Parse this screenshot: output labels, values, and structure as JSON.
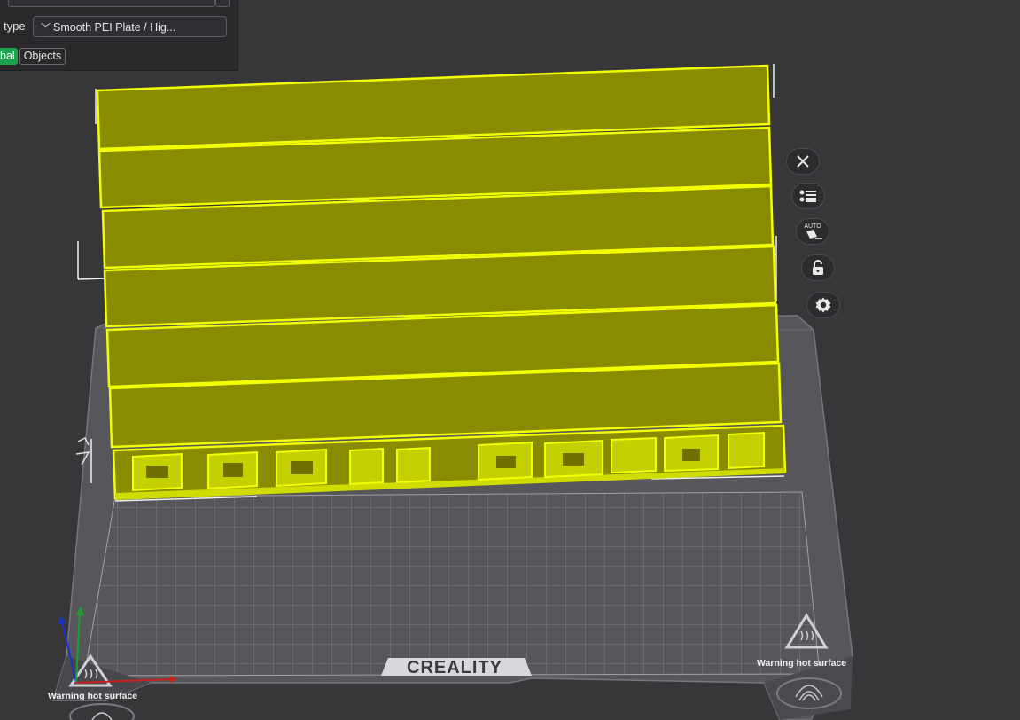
{
  "panel": {
    "type_label": "type",
    "plate_type_value": "Smooth PEI Plate / Hig...",
    "tabs": {
      "global": "bal",
      "objects": "Objects"
    }
  },
  "bed": {
    "brand": "CREALITY",
    "warning_left": "Warning hot surface",
    "warning_right": "Warning hot surface"
  },
  "model": {
    "color": "#8a8c00",
    "outline": "#f2ff00",
    "text_ridge_color": "#e8f200"
  },
  "toolbar": {
    "auto_label": "AUTO",
    "icons": [
      "close-icon",
      "list-icon",
      "auto-orient-icon",
      "lock-icon",
      "gear-icon"
    ]
  }
}
